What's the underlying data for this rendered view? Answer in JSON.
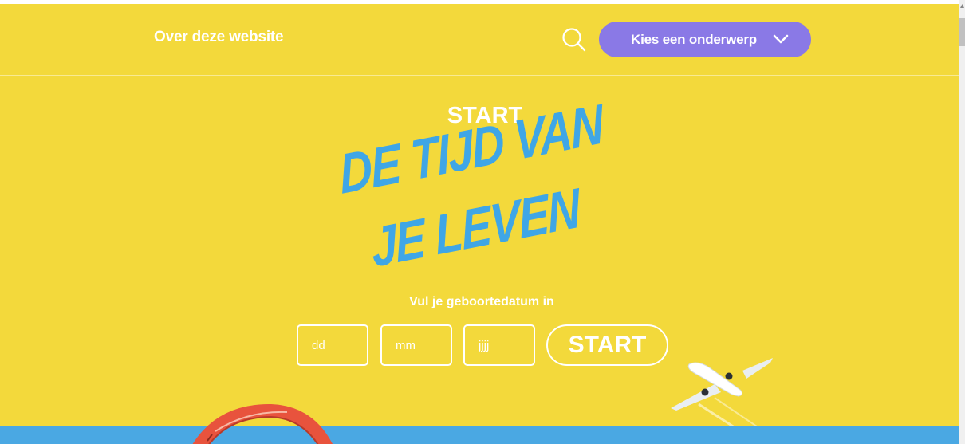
{
  "header": {
    "about_label": "Over deze website",
    "search_icon": "search-icon",
    "topic_button_label": "Kies een onderwerp",
    "topic_chevron_icon": "chevron-down-icon"
  },
  "hero": {
    "kicker": "START",
    "title_line1": "DE TIJD VAN",
    "title_line2": "JE LEVEN"
  },
  "birthdate_form": {
    "label": "Vul je geboortedatum in",
    "day_placeholder": "dd",
    "month_placeholder": "mm",
    "year_placeholder": "jjjj",
    "submit_label": "START"
  },
  "colors": {
    "background": "#f3d93b",
    "accent_purple": "#8a79e6",
    "title_blue": "#3fa6e6",
    "sky_blue": "#4aa8e3"
  }
}
